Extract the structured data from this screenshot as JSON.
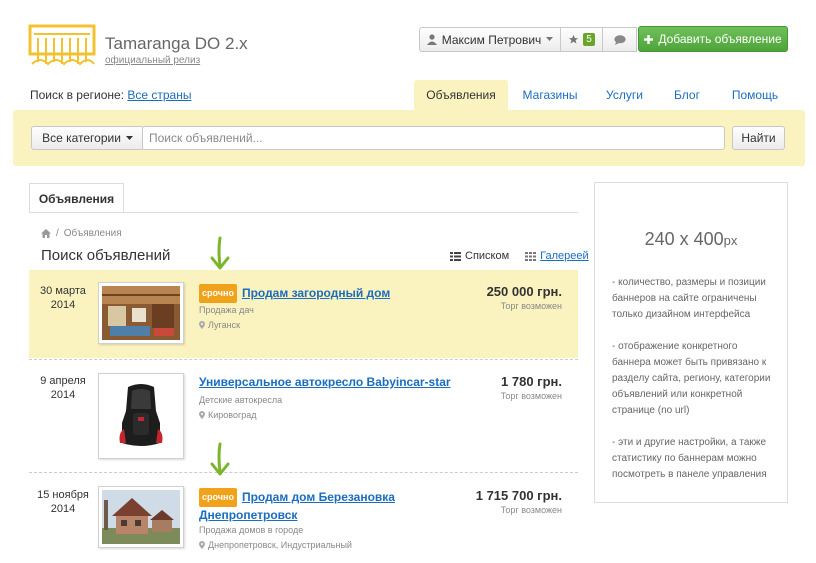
{
  "header": {
    "title": "Tamaranga DO 2.x",
    "subtitle": "официальный релиз"
  },
  "userbar": {
    "user_name": "Максим Петрович",
    "favorites_count": "5",
    "add_button_label": "Добавить объявление"
  },
  "region": {
    "label": "Поиск в регионе:",
    "value": "Все страны"
  },
  "tabs": [
    {
      "label": "Объявления",
      "active": true
    },
    {
      "label": "Магазины",
      "active": false
    },
    {
      "label": "Услуги",
      "active": false
    },
    {
      "label": "Блог",
      "active": false
    },
    {
      "label": "Помощь",
      "active": false
    }
  ],
  "search": {
    "category_label": "Все категории",
    "placeholder": "Поиск объявлений...",
    "button_label": "Найти"
  },
  "content": {
    "tab_label": "Объявления",
    "breadcrumb_current": "Объявления",
    "page_title": "Поиск объявлений",
    "view_list_label": "Списком",
    "view_gallery_label": "Галереей"
  },
  "listings": [
    {
      "date_line1": "30 марта",
      "date_line2": "2014",
      "urgent": true,
      "urgent_label": "срочно",
      "title": "Продам загородный дом",
      "category": "Продажа дач",
      "location": "Луганск",
      "price": "250 000 грн.",
      "price_note": "Торг возможен",
      "highlighted": true
    },
    {
      "date_line1": "9 апреля",
      "date_line2": "2014",
      "urgent": false,
      "title": "Универсальное автокресло Babyincar-star",
      "category": "Детские автокресла",
      "location": "Кировоград",
      "price": "1 780 грн.",
      "price_note": "Торг возможен",
      "highlighted": false
    },
    {
      "date_line1": "15 ноября",
      "date_line2": "2014",
      "urgent": true,
      "urgent_label": "срочно",
      "title_line1": "Продам дом Березановка",
      "title_line2": "Днепропетровск",
      "category": "Продажа домов в городе",
      "location": "Днепропетровск, Индустриальный",
      "price": "1 715 700 грн.",
      "price_note": "Торг возможен",
      "highlighted": false
    }
  ],
  "banner": {
    "size": "240 x 400",
    "unit": "px",
    "notes": [
      "- количество, размеры и позиции баннеров на сайте ограничены только дизайном интерфейса",
      "- отображение конкретного баннера может быть привязано к разделу сайта, региону, категории объявлений или конкретной странице (no url)",
      "- эти и другие настройки, а также статистику по баннерам можно посмотреть в панеле управления"
    ]
  },
  "colors": {
    "accent_yellow": "#fbf3bf",
    "link_blue": "#1a6dbf",
    "add_button_green": "#5cb347",
    "urgent_orange": "#f0a21b",
    "logo_yellow": "#f2c230",
    "arrow_green": "#7ab52a"
  },
  "icons": [
    "logo-icon",
    "user-icon",
    "caret-down-icon",
    "star-icon",
    "chat-icon",
    "plus-icon",
    "home-icon",
    "list-icon",
    "grid-icon",
    "map-pin-icon",
    "arrow-down-icon"
  ]
}
